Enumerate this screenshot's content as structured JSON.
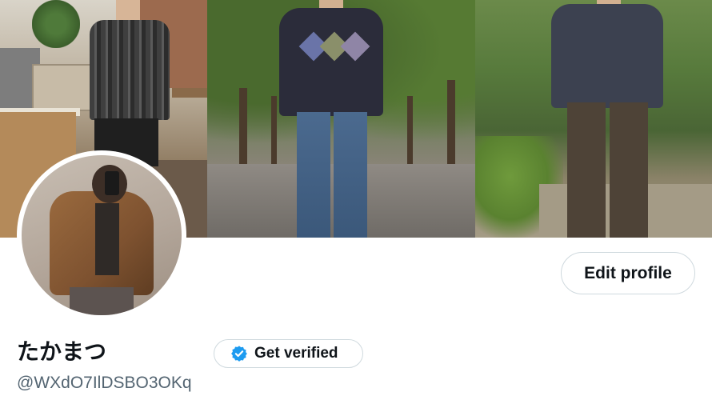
{
  "profile": {
    "display_name": "たかまつ",
    "handle": "@WXdO7IlDSBO3OKq",
    "edit_profile_label": "Edit profile",
    "get_verified_label": "Get verified"
  },
  "banner": {
    "panels": [
      "cafe-outfit-photo",
      "park-argyle-sweater-photo",
      "garden-cardigan-photo"
    ]
  },
  "icons": {
    "verified": "verified-badge-icon"
  },
  "colors": {
    "verified_blue": "#1d9bf0",
    "text_primary": "#0f1419",
    "text_secondary": "#536471",
    "border": "#cfd9de"
  }
}
